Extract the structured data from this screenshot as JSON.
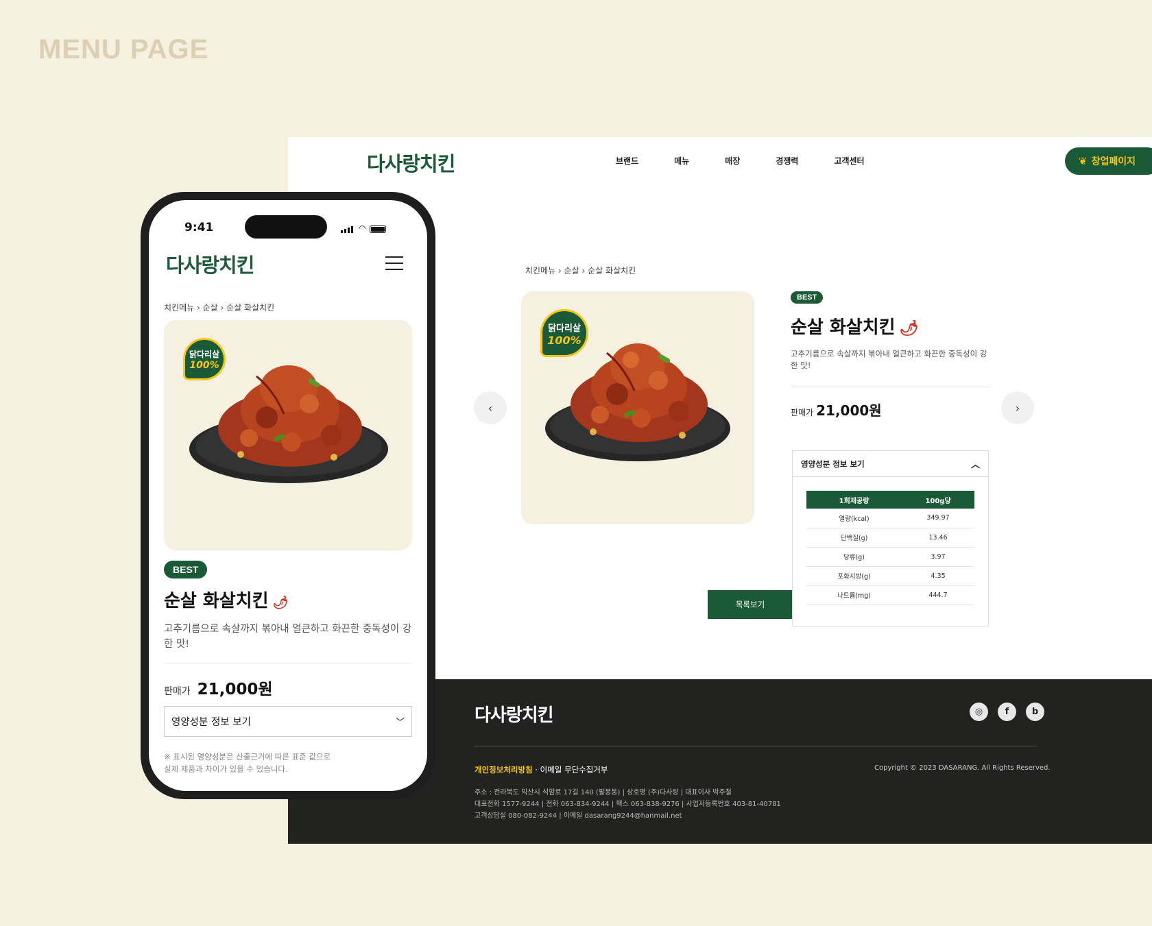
{
  "page_label": "MENU PAGE",
  "brand": {
    "logo": "다사랑치킨"
  },
  "header": {
    "nav": [
      "브랜드",
      "메뉴",
      "매장",
      "경쟁력",
      "고객센터"
    ],
    "cta_label": "창업페이지"
  },
  "breadcrumb": [
    "치킨메뉴",
    "순살",
    "순살 화살치킨"
  ],
  "product": {
    "badge": "BEST",
    "name": "순살 화살치킨",
    "description": "고추기름으로 속살까지 볶아내 얼큰하고 화끈한 중독성이 강한 맛!",
    "price_label": "판매가",
    "price": "21,000원",
    "image_tag_line1": "닭다리살",
    "image_tag_line2": "100%"
  },
  "nutrition": {
    "toggle_label": "영양성분 정보 보기",
    "headers": [
      "1회제공량",
      "100g당"
    ],
    "rows": [
      {
        "name": "열량(kcal)",
        "value": "349.97"
      },
      {
        "name": "단백질(g)",
        "value": "13.46"
      },
      {
        "name": "당류(g)",
        "value": "3.97"
      },
      {
        "name": "포화지방(g)",
        "value": "4.35"
      },
      {
        "name": "나트륨(mg)",
        "value": "444.7"
      }
    ],
    "note_line1": "※ 표시된 영양성분은 산출근거에 따른 표준 값으로",
    "note_line2": "실제 제품과 차이가 있을 수 있습니다."
  },
  "list_button": "목록보기",
  "footer": {
    "privacy": "개인정보처리방침",
    "email_refuse": "이메일 무단수집거부",
    "copyright": "Copyright © 2023 DASARANG. All Rights Reserved.",
    "address": "주소 : 전라북도 익산시 석암로 17길 140 (팔봉동) | 상호명 (주)다사랑 | 대표이사 박주철",
    "phones": "대표전화 1577-9244 | 전화 063-834-9244  |  팩스 063-838-9276  |  사업자등록번호 403-81-40781",
    "contact": "고객상담실 080-082-9244 | 이메일 dasarang9244@hanmail.net",
    "social_icons": [
      "instagram-icon",
      "facebook-icon",
      "blog-icon"
    ]
  },
  "phone_status": {
    "time": "9:41"
  },
  "colors": {
    "brand_green": "#1b5a37",
    "accent_yellow": "#f5c518",
    "background": "#f6f0e1",
    "footer": "#222221"
  }
}
